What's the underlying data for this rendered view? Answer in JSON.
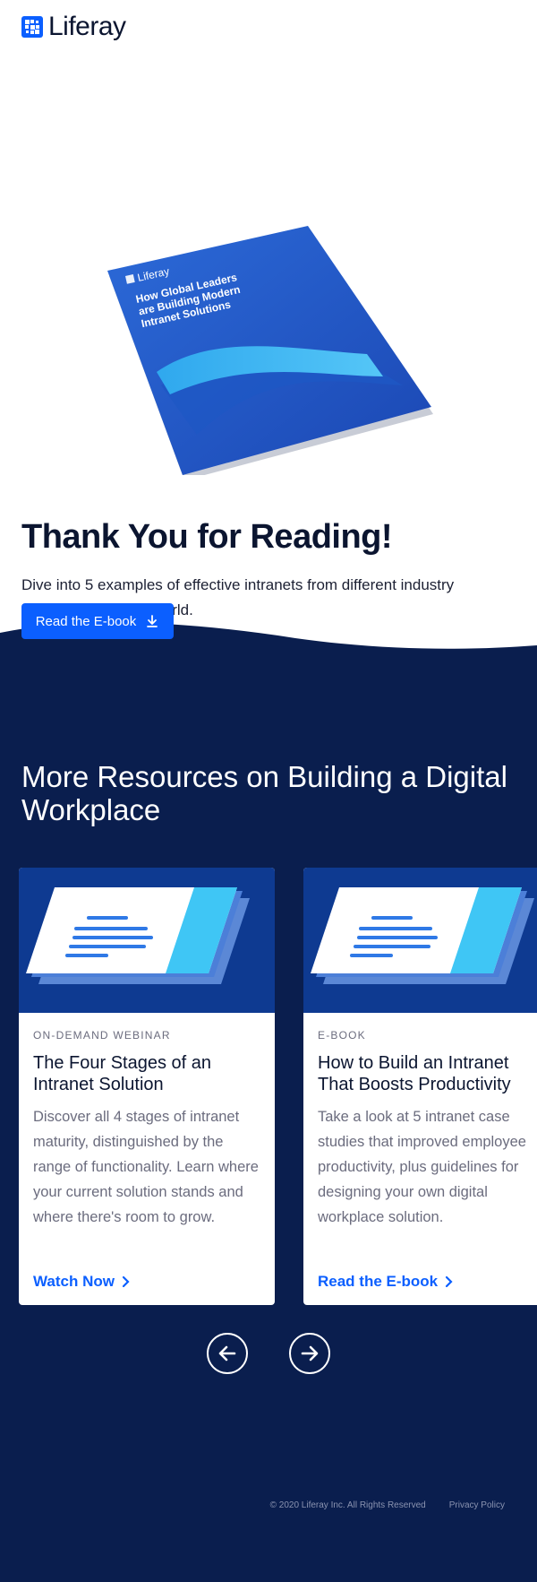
{
  "header": {
    "logo_text": "Liferay",
    "logo_icon": "liferay-logo-icon"
  },
  "hero": {
    "book": {
      "brand": "Liferay",
      "title_lines": [
        "How Global Leaders",
        "are Building Modern",
        "Intranet Solutions"
      ]
    },
    "title": "Thank You for Reading!",
    "description": "Dive into 5 examples of effective intranets from different industry leaders around the world.",
    "cta_label": "Read the E-book",
    "cta_icon": "download-icon"
  },
  "resources": {
    "title": "More Resources on Building a Digital Workplace",
    "cards": [
      {
        "type": "ON-DEMAND WEBINAR",
        "title": "The Four Stages of an Intranet Solution",
        "description": "Discover all 4 stages of intranet maturity, distinguished by the range of functionality. Learn where your current solution stands and where there's room to grow.",
        "link": "Watch Now"
      },
      {
        "type": "E-BOOK",
        "title": "How to Build an Intranet That Boosts Productivity",
        "description": "Take a look at 5 intranet case studies that improved employee productivity, plus guidelines for designing your own digital workplace solution.",
        "link": "Read the E-book"
      }
    ],
    "prev_icon": "arrow-left-icon",
    "next_icon": "arrow-right-icon"
  },
  "footer": {
    "copyright": "© 2020 Liferay Inc. All Rights Reserved",
    "privacy": "Privacy Policy"
  },
  "colors": {
    "brand_blue": "#0b5fff",
    "navy": "#0a1e4e",
    "text_dark": "#0b1530"
  }
}
